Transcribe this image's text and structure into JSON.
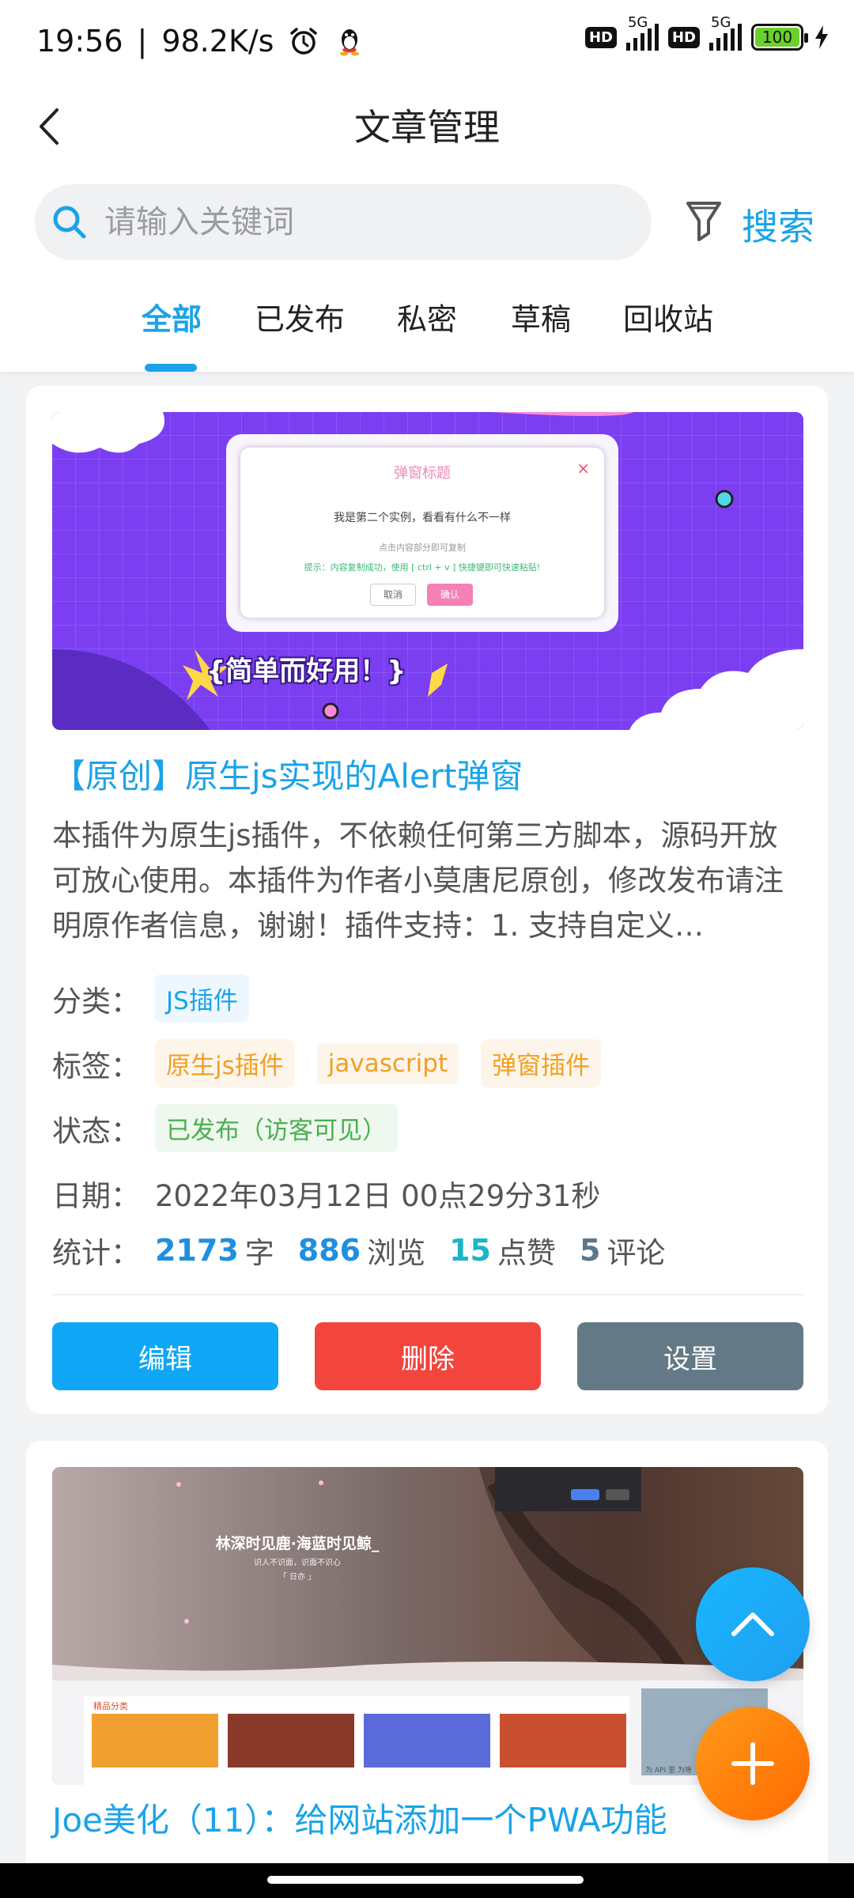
{
  "status": {
    "time": "19:56",
    "separator": "|",
    "speed": "98.2K/s",
    "net1": "5G",
    "net2": "5G",
    "hd1": "HD",
    "hd2": "HD",
    "battery": "100"
  },
  "header": {
    "title": "文章管理",
    "search_placeholder": "请输入关键词",
    "search_label": "搜索"
  },
  "tabs": [
    {
      "label": "全部"
    },
    {
      "label": "已发布"
    },
    {
      "label": "私密"
    },
    {
      "label": "草稿"
    },
    {
      "label": "回收站"
    }
  ],
  "posts": [
    {
      "cover": {
        "dialog_title": "弹窗标题",
        "dialog_close": "×",
        "dialog_text": "我是第二个实例，看看有什么不一样",
        "dialog_hint": "点击内容部分即可复制",
        "dialog_tip": "提示：内容复制成功，使用 [ ctrl + v ] 快捷键即可快速粘贴!",
        "btn_cancel": "取消",
        "btn_ok": "确认",
        "slogan": "{简单而好用！}"
      },
      "title": "【原创】原生js实现的Alert弹窗",
      "excerpt": "本插件为原生js插件，不依赖任何第三方脚本，源码开放可放心使用。本插件为作者小莫唐尼原创，修改发布请注明原作者信息，谢谢！插件支持：1. 支持自定义…",
      "category_label": "分类：",
      "category": "JS插件",
      "tags_label": "标签：",
      "tags": [
        "原生js插件",
        "javascript",
        "弹窗插件"
      ],
      "status_label": "状态：",
      "status": "已发布（访客可见）",
      "date_label": "日期：",
      "date": "2022年03月12日 00点29分31秒",
      "stats_label": "统计：",
      "words": "2173",
      "words_unit": "字",
      "views": "886",
      "views_unit": "浏览",
      "likes": "15",
      "likes_unit": "点赞",
      "comments": "5",
      "comments_unit": "评论",
      "edit_label": "编辑",
      "delete_label": "删除",
      "settings_label": "设置"
    },
    {
      "cover": {
        "headline": "林深时见鹿·海蓝时见鲸_",
        "subline": "识人不识面，识面不识心",
        "subline2": "「 日亦 」",
        "section": "精品分类",
        "sidebar_cap": "为 API 里 为啥"
      },
      "title": "Joe美化（11）：给网站添加一个PWA功能"
    }
  ],
  "colors": {
    "accent": "#1aa3e8",
    "edit": "#0fa7f5",
    "delete": "#f2453d",
    "settings": "#637a86"
  }
}
